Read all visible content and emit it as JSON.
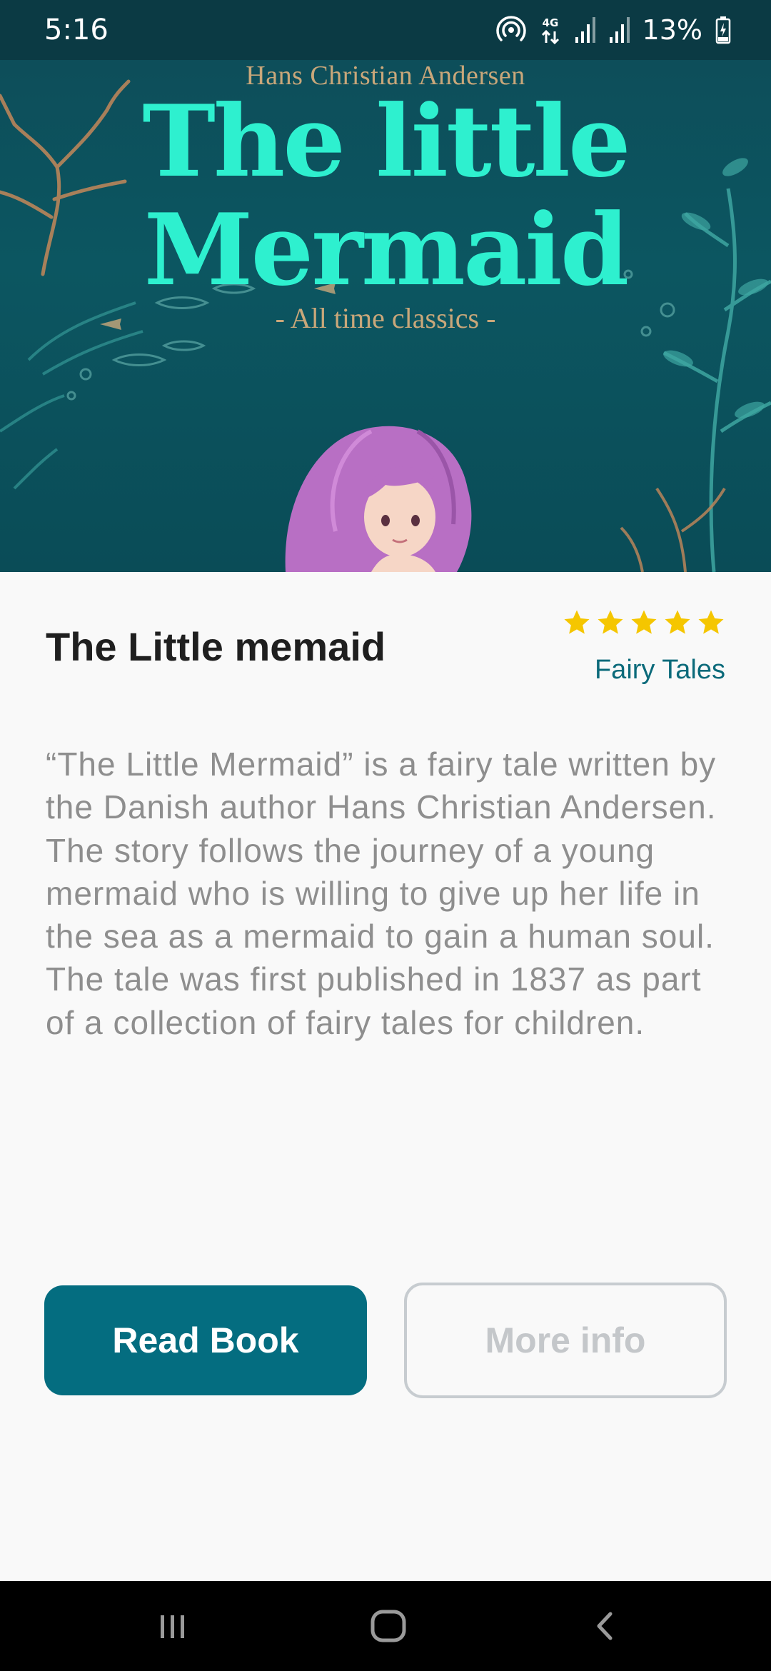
{
  "status_bar": {
    "time": "5:16",
    "network_label": "4G",
    "battery": "13%",
    "icons": [
      "hotspot-icon",
      "network-4g-icon",
      "signal-icon",
      "signal-icon",
      "battery-charging-icon"
    ]
  },
  "cover": {
    "author": "Hans Christian Andersen",
    "title_line1": "The little",
    "title_line2": "Mermaid",
    "subtitle": "- All time classics -",
    "colors": {
      "background": "#0c5661",
      "title": "#2ef0cf",
      "accent": "#c9a77a",
      "hair": "#b86fc4"
    }
  },
  "book": {
    "title": "The Little memaid",
    "rating": 5,
    "rating_max": 5,
    "genre": "Fairy Tales",
    "description": "“The Little Mermaid” is a fairy tale written by the Danish author Hans Christian Andersen. The story follows the journey of a young mermaid who is willing to give up her life in the sea as a mermaid to gain a human soul. The tale was first published in 1837 as part of a collection of fairy tales for children."
  },
  "actions": {
    "read_label": "Read Book",
    "more_label": "More info"
  },
  "colors": {
    "primary": "#046d80",
    "genre": "#0b6a7a",
    "star": "#f5c600",
    "title_text": "#1f1f1f",
    "description_text": "#8e8e8e",
    "disabled": "#c4c7ca"
  },
  "nav": {
    "icons": [
      "recent-apps-icon",
      "home-icon",
      "back-icon"
    ]
  }
}
